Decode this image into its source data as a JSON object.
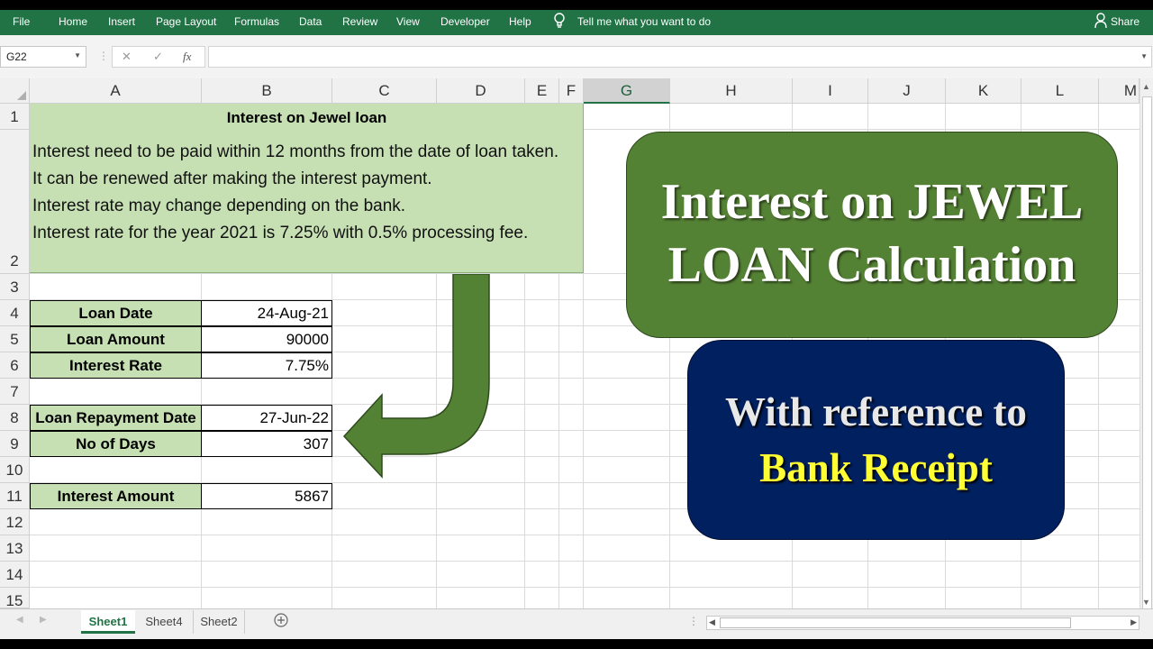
{
  "ribbon": {
    "tabs": [
      "File",
      "Home",
      "Insert",
      "Page Layout",
      "Formulas",
      "Data",
      "Review",
      "View",
      "Developer",
      "Help"
    ],
    "tell_me": "Tell me what you want to do",
    "share": "Share"
  },
  "formula_bar": {
    "name_box": "G22",
    "fx": "fx",
    "value": ""
  },
  "columns": [
    "A",
    "B",
    "C",
    "D",
    "E",
    "F",
    "G",
    "H",
    "I",
    "J",
    "K",
    "L",
    "M"
  ],
  "selected_column": "G",
  "rows": [
    "1",
    "2",
    "3",
    "4",
    "5",
    "6",
    "7",
    "8",
    "9",
    "10",
    "11",
    "12",
    "13",
    "14",
    "15"
  ],
  "info": {
    "title": "Interest on Jewel loan",
    "lines": [
      "Interest need to be paid within 12 months from the date of loan taken.",
      "It can be renewed after making the interest payment.",
      "Interest rate may change depending on the bank.",
      "Interest rate for the year 2021 is 7.25% with 0.5% processing fee."
    ]
  },
  "table": {
    "loan_date_label": "Loan Date",
    "loan_date": "24-Aug-21",
    "loan_amount_label": "Loan Amount",
    "loan_amount": "90000",
    "interest_rate_label": "Interest Rate",
    "interest_rate": "7.75%",
    "repayment_date_label": "Loan Repayment Date",
    "repayment_date": "27-Jun-22",
    "days_label": "No of Days",
    "days": "307",
    "interest_amount_label": "Interest Amount",
    "interest_amount": "5867"
  },
  "banner": {
    "line1": "Interest on JEWEL",
    "line2": "LOAN Calculation"
  },
  "reference": {
    "line1": "With reference to",
    "line2": "Bank Receipt"
  },
  "sheets": [
    "Sheet1",
    "Sheet4",
    "Sheet2"
  ],
  "active_sheet": "Sheet1",
  "colors": {
    "excel_green": "#217346",
    "label_fill": "#c6e0b4",
    "banner_green": "#548235",
    "banner_blue": "#002060",
    "highlight_yellow": "#ffff33"
  }
}
